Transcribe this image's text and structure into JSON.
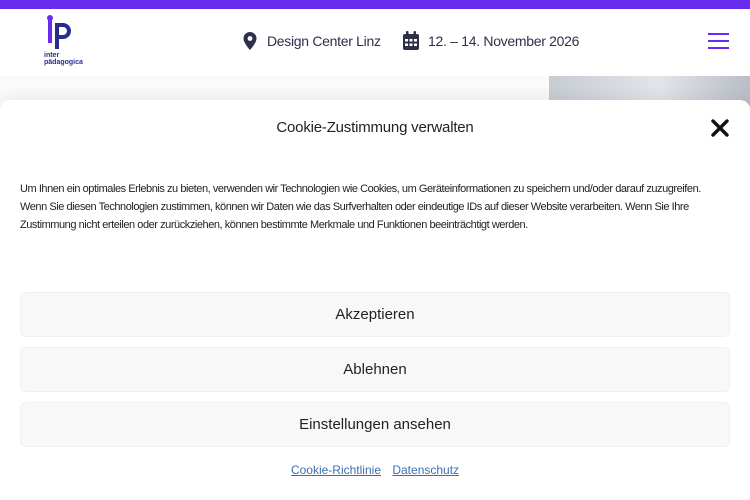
{
  "colors": {
    "accent": "#6a2bf0",
    "logo": "#2b2b8f",
    "link": "#3b6fb4",
    "button_bg": "#f8f8f8"
  },
  "header": {
    "logo": {
      "line1": "inter",
      "line2": "pädagogica"
    },
    "location": {
      "icon": "map-pin-icon",
      "text": "Design Center Linz"
    },
    "date": {
      "icon": "calendar-icon",
      "text": "12. – 14. November 2026"
    },
    "menu_icon": "hamburger-menu-icon"
  },
  "cookie_modal": {
    "title": "Cookie-Zustimmung verwalten",
    "close_icon": "close-icon",
    "text": "Um Ihnen ein optimales Erlebnis zu bieten, verwenden wir Technologien wie Cookies, um Geräteinformationen zu speichern und/oder darauf zuzugreifen. Wenn Sie diesen Technologien zustimmen, können wir Daten wie das Surfverhalten oder eindeutige IDs auf dieser Website verarbeiten. Wenn Sie Ihre Zustimmung nicht erteilen oder zurückziehen, können bestimmte Merkmale und Funktionen beeinträchtigt werden.",
    "buttons": {
      "accept": "Akzeptieren",
      "deny": "Ablehnen",
      "preferences": "Einstellungen ansehen"
    },
    "links": {
      "cookie_policy": "Cookie-Richtlinie",
      "privacy": "Datenschutz"
    }
  }
}
